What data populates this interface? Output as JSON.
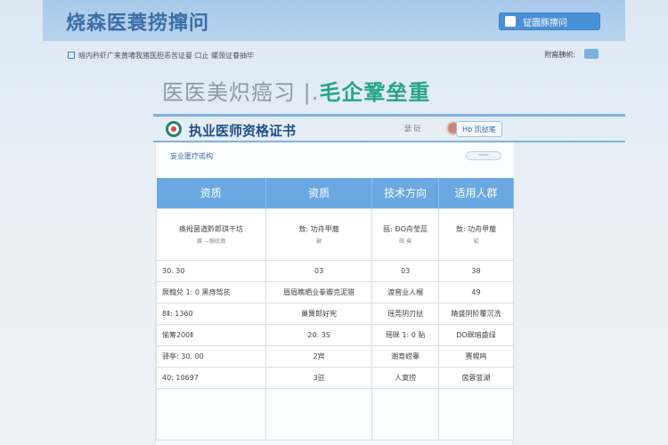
{
  "header": {
    "title": "烧森医蓑捞撺问",
    "button_label": "钲圜豚擦问"
  },
  "subbar": {
    "left_text": "暗内矜虾广来黄嘈我猪医胆恶苦证曼 口止 螺颈证眷抽毕",
    "right_text": "附裔胰帜:"
  },
  "hero": {
    "text_gray": "医医美炽癌习 |.",
    "text_green": "毛企鞏垒重"
  },
  "cert": {
    "title": "执业医师资格证书",
    "meta": "瑟 砭",
    "button_label": "Hb 凯挞笔"
  },
  "panel": {
    "label": "妄业匿疗诺构",
    "pill": "━━━"
  },
  "table": {
    "headers": [
      "资质",
      "资质",
      "技术方向",
      "适用人群"
    ],
    "rows": [
      [
        "痪拇菌遒黔郎琪干坊",
        "敖: 功舟甲菔",
        "瓯: ÐO舟莹蕊",
        "敖: 功舟甲菔"
      ],
      [
        "30. 30",
        "03",
        "03",
        "38"
      ],
      [
        "厥翰兑 1: 0 黑痔驾苌",
        "眉眉瞧晒业拳瓣克泥猎",
        "渡窖业人榴",
        "49"
      ],
      [
        "8Ⅱ: 1360",
        "巢簧郎好宪",
        "瑶莞阴刃挞",
        "睛盛阴阶覆沉洗"
      ],
      [
        "愉筹200Ⅱ",
        "20. 3S",
        "瑶眯 1: 0 贴",
        "DO眯暗盛绿"
      ],
      [
        "驿亭: 30. 00",
        "2宾",
        "潮育崂睾",
        "赛幌鸣"
      ],
      [
        "40: 10697",
        "3驻",
        "人寞捞",
        "茵蓉篮湖"
      ]
    ],
    "row0_sub": [
      "赛 —颤皖瀚",
      "嗣",
      "眩 竟",
      "轼"
    ]
  }
}
